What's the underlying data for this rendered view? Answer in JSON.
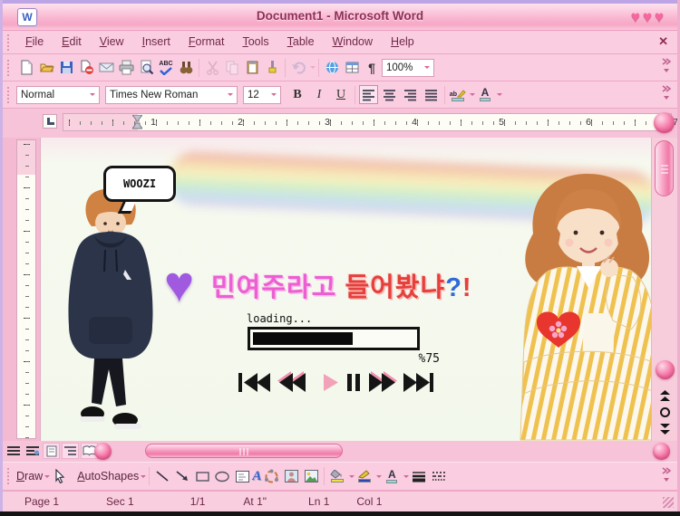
{
  "window": {
    "title": "Document1 - Microsoft Word",
    "icon_letter": "W",
    "heart_glyph": "♥♥♥"
  },
  "menu_bar": {
    "items": [
      "File",
      "Edit",
      "View",
      "Insert",
      "Format",
      "Tools",
      "Table",
      "Window",
      "Help"
    ],
    "close_glyph": "✕"
  },
  "standard_toolbar": {
    "zoom_value": "100%",
    "spelling_label": "ABC",
    "pilcrow": "¶",
    "icons": [
      "new-document",
      "open",
      "save",
      "permission",
      "email",
      "print",
      "print-preview",
      "spelling-grammar",
      "research",
      "cut",
      "copy",
      "paste",
      "format-painter",
      "undo",
      "insert-hyperlink",
      "tables-and-borders",
      "show-hide-formatting",
      "zoom"
    ]
  },
  "formatting_toolbar": {
    "style_value": "Normal",
    "font_value": "Times New Roman",
    "size_value": "12",
    "bold_label": "B",
    "italic_label": "I",
    "underline_label": "U",
    "highlight_ab": "ab",
    "font_color_letter": "A",
    "alignment_icons": [
      "align-left",
      "center",
      "align-right",
      "justify"
    ]
  },
  "ruler": {
    "numbers": [
      "1",
      "2",
      "3",
      "4",
      "5",
      "6",
      "7"
    ]
  },
  "document": {
    "speech_bubble_text": "WOOZI",
    "heading": {
      "part_pink": "민여주라고",
      "part_red": " 들어봤냐",
      "question_mark": "?",
      "exclamation_mark": "!"
    },
    "loading": {
      "label": "loading...",
      "percent_label": "%75",
      "fill_style": "width:62%"
    },
    "media_player": {
      "buttons": [
        "skip-back",
        "rewind",
        "play",
        "pause",
        "fast-forward",
        "skip-forward"
      ]
    },
    "photos": [
      {
        "name": "woozi-photo"
      },
      {
        "name": "park-bo-young-photo"
      }
    ],
    "emojis": [
      "purple-heart",
      "red-heart-with-flower"
    ]
  },
  "drawing_toolbar": {
    "draw_label": "Draw",
    "autoshapes_label": "AutoShapes",
    "wordart_letter": "A",
    "font_color_letter": "A",
    "icons": [
      "select-objects",
      "line",
      "arrow",
      "rectangle",
      "oval",
      "text-box",
      "wordart",
      "diagram",
      "clip-art",
      "picture",
      "fill-color",
      "line-color",
      "font-color",
      "line-style",
      "dash-style"
    ]
  },
  "status_bar": {
    "page": "Page 1",
    "section": "Sec 1",
    "page_of": "1/1",
    "at": "At 1\"",
    "line": "Ln 1",
    "column": "Col 1"
  },
  "colors": {
    "accent_pink": "#f672a8",
    "titlebar_text": "#8e3055",
    "heading_pink": "#ec5fd2",
    "heading_red": "#e5403c",
    "question_blue": "#2f6bd8",
    "purple_heart": "#a05ae0"
  }
}
